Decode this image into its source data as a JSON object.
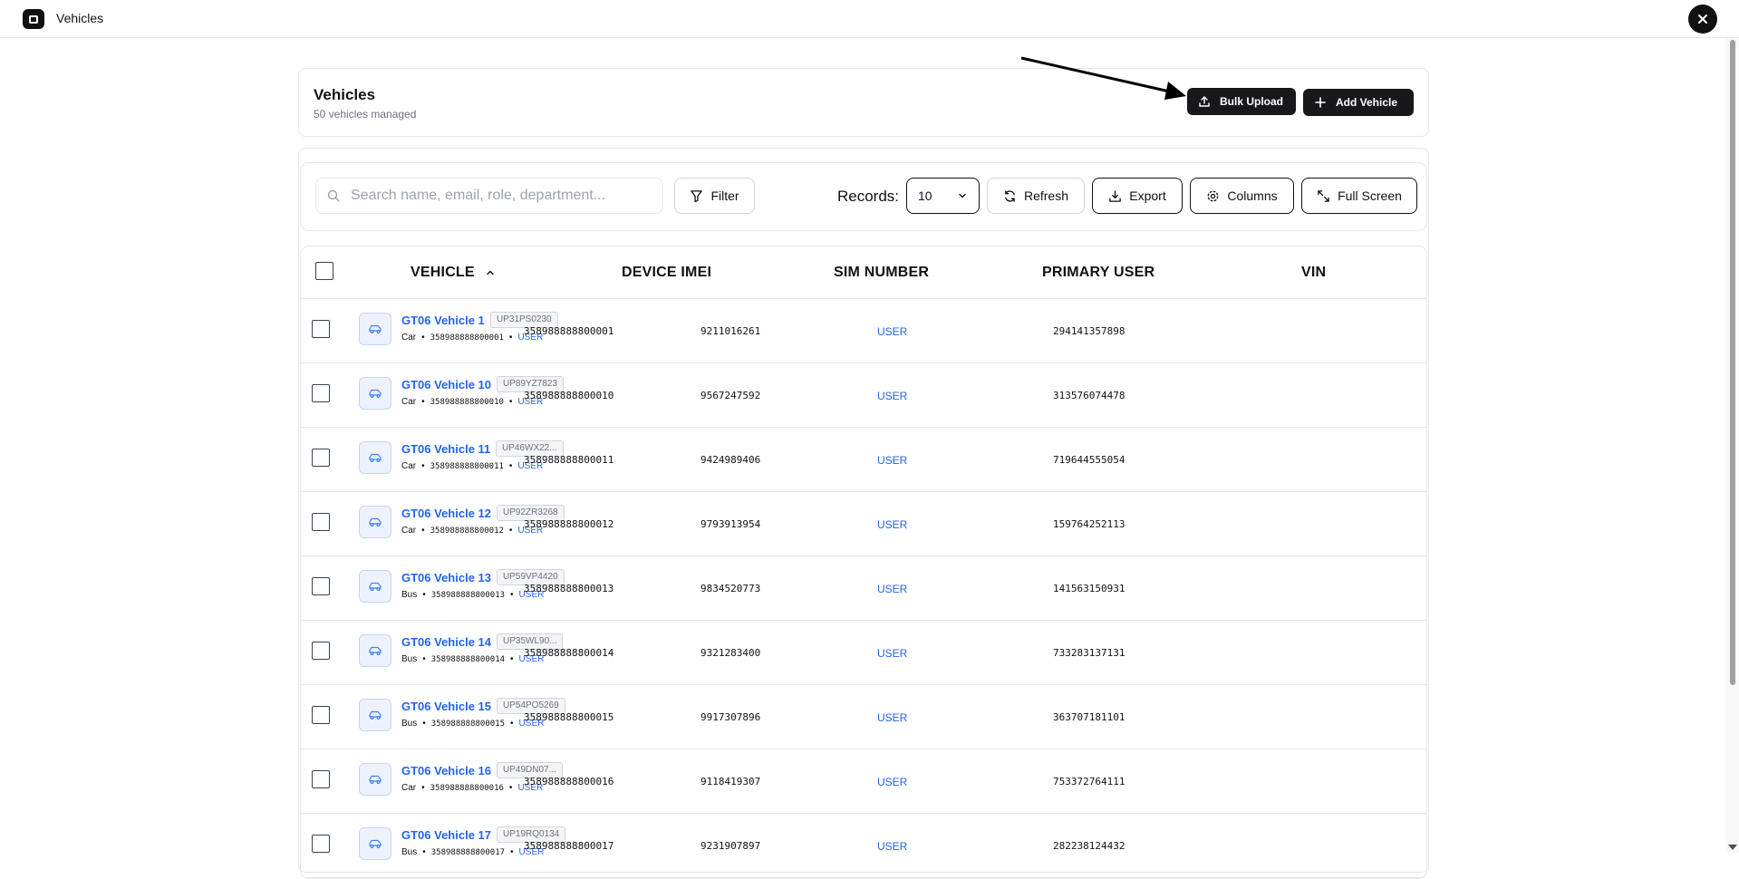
{
  "window": {
    "title": "Vehicles"
  },
  "header": {
    "title": "Vehicles",
    "subtitle": "50 vehicles managed",
    "bulk_upload_label": "Bulk Upload",
    "add_vehicle_label": "Add Vehicle"
  },
  "toolbar": {
    "search_placeholder": "Search name, email, role, department...",
    "filter_label": "Filter",
    "records_label": "Records:",
    "records_value": "10",
    "refresh_label": "Refresh",
    "export_label": "Export",
    "columns_label": "Columns",
    "fullscreen_label": "Full Screen"
  },
  "table": {
    "columns": [
      "VEHICLE",
      "DEVICE IMEI",
      "SIM NUMBER",
      "PRIMARY USER",
      "VIN"
    ],
    "rows": [
      {
        "name": "GT06 Vehicle 1",
        "plate": "UP31PS0230",
        "type": "Car",
        "imei": "358988888800001",
        "user": "USER",
        "sim": "9211016261",
        "vin": "294141357898"
      },
      {
        "name": "GT06 Vehicle 10",
        "plate": "UP89YZ7823",
        "type": "Car",
        "imei": "358988888800010",
        "user": "USER",
        "sim": "9567247592",
        "vin": "313576074478"
      },
      {
        "name": "GT06 Vehicle 11",
        "plate": "UP46WX22...",
        "type": "Car",
        "imei": "358988888800011",
        "user": "USER",
        "sim": "9424989406",
        "vin": "719644555054"
      },
      {
        "name": "GT06 Vehicle 12",
        "plate": "UP92ZR3268",
        "type": "Car",
        "imei": "358988888800012",
        "user": "USER",
        "sim": "9793913954",
        "vin": "159764252113"
      },
      {
        "name": "GT06 Vehicle 13",
        "plate": "UP59VP4420",
        "type": "Bus",
        "imei": "358988888800013",
        "user": "USER",
        "sim": "9834520773",
        "vin": "141563150931"
      },
      {
        "name": "GT06 Vehicle 14",
        "plate": "UP35WL90...",
        "type": "Bus",
        "imei": "358988888800014",
        "user": "USER",
        "sim": "9321283400",
        "vin": "733283137131"
      },
      {
        "name": "GT06 Vehicle 15",
        "plate": "UP54PO5269",
        "type": "Bus",
        "imei": "358988888800015",
        "user": "USER",
        "sim": "9917307896",
        "vin": "363707181101"
      },
      {
        "name": "GT06 Vehicle 16",
        "plate": "UP49DN07...",
        "type": "Car",
        "imei": "358988888800016",
        "user": "USER",
        "sim": "9118419307",
        "vin": "753372764111"
      },
      {
        "name": "GT06 Vehicle 17",
        "plate": "UP19RQ0134",
        "type": "Bus",
        "imei": "358988888800017",
        "user": "USER",
        "sim": "9231907897",
        "vin": "282238124432"
      }
    ]
  }
}
